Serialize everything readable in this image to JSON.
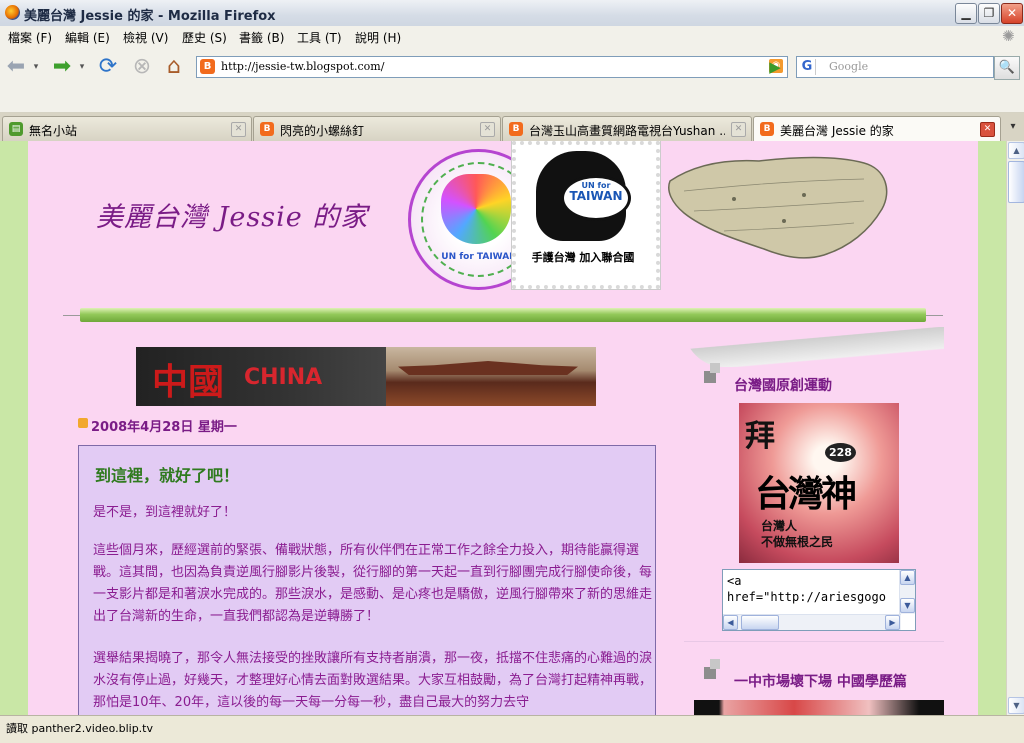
{
  "window": {
    "title": "美麗台灣 Jessie 的家 - Mozilla Firefox",
    "app_icon": "firefox-icon",
    "controls": [
      "minimize",
      "maximize",
      "close"
    ]
  },
  "menu": [
    "檔案 (F)",
    "編輯 (E)",
    "檢視 (V)",
    "歷史 (S)",
    "書籤 (B)",
    "工具 (T)",
    "說明 (H)"
  ],
  "toolbar": {
    "url": "http://jessie-tw.blogspot.com/",
    "search_placeholder": "Google",
    "search_engine_letter": "G"
  },
  "tabs": [
    {
      "label": "無名小站",
      "icon": "wretch-icon",
      "active": false
    },
    {
      "label": "閃亮的小螺絲釘",
      "icon": "blogger-icon",
      "active": false
    },
    {
      "label": "台灣玉山高畫質網路電視台Yushan ...",
      "icon": "blogger-icon",
      "active": false
    },
    {
      "label": "美麗台灣 Jessie 的家",
      "icon": "blogger-icon",
      "active": true
    }
  ],
  "blog": {
    "title": "美麗台灣 Jessie 的家",
    "stamp_un": {
      "line1": "UN for",
      "line2": "TAIWAN",
      "caption": "手護台灣 加入聯合國"
    },
    "stamp_round_text": "UN for TAIWAN"
  },
  "banner": {
    "cn": "中國",
    "en": "CHINA"
  },
  "post": {
    "date": "2008年4月28日 星期一",
    "title": "到這裡，就好了吧！",
    "paragraphs": [
      "是不是，到這裡就好了！",
      "這些個月來，歷經選前的緊張、備戰狀態，所有伙伴們在正常工作之餘全力投入，期待能贏得選戰。這其間，也因為負責逆風行腳影片後製，從行腳的第一天起一直到行腳團完成行腳使命後，每一支影片都是和著淚水完成的。那些淚水，是感動、是心疼也是驕傲，逆風行腳帶來了新的思維走出了台灣新的生命，一直我們都認為是逆轉勝了！",
      "選舉結果揭曉了，那令人無法接受的挫敗讓所有支持者崩潰，那一夜，抵擋不住悲痛的心難過的淚水沒有停止過，好幾天，才整理好心情去面對敗選結果。大家互相鼓勵，為了台灣打起精神再戰，那怕是10年、20年，這以後的每一天每一分每一秒，盡自己最大的努力去守"
    ]
  },
  "sidebar": {
    "widget1_title": "台灣國原創運動",
    "image1": {
      "top": "拜",
      "badge": "228",
      "big": "台灣神",
      "cap1": "台灣人",
      "cap2": "不做無根之民"
    },
    "code_text": "<a\nhref=\"http://ariesgogo",
    "widget2_title": "一中市場壞下場 中國學歷篇"
  },
  "status": {
    "text": "讀取 panther2.video.blip.tv"
  }
}
